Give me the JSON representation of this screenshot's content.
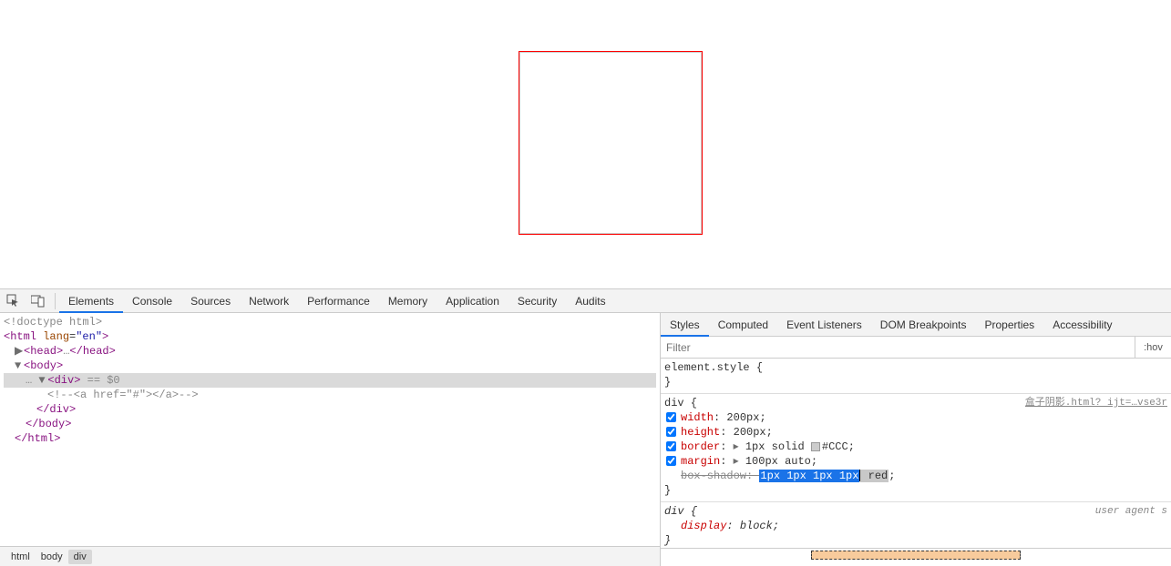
{
  "tabs": [
    "Elements",
    "Console",
    "Sources",
    "Network",
    "Performance",
    "Memory",
    "Application",
    "Security",
    "Audits"
  ],
  "domLines": [
    {
      "indent": 0,
      "html": "<span class='gray'>&lt;!doctype html&gt;</span>"
    },
    {
      "indent": 0,
      "html": "<span class='tagc'>&lt;html </span><span class='attrn'>lang</span>=<span class='attrv'>\"en\"</span><span class='tagc'>&gt;</span>"
    },
    {
      "indent": 1,
      "html": "<span class='arrow'>▶</span><span class='tagc'>&lt;head&gt;</span><span class='gray'>…</span><span class='tagc'>&lt;/head&gt;</span>"
    },
    {
      "indent": 1,
      "html": "<span class='arrow'>▼</span><span class='tagc'>&lt;body&gt;</span>"
    },
    {
      "indent": 2,
      "selected": true,
      "html": "<span class='gray'>…</span> <span class='arrow'>▼</span><span class='tagc'>&lt;div&gt;</span> <span class='eq0'>== $0</span>"
    },
    {
      "indent": 4,
      "html": "<span class='gray'>&lt;!--&lt;a href=\"#\"&gt;&lt;/a&gt;--&gt;</span>"
    },
    {
      "indent": 3,
      "html": "<span class='tagc'>&lt;/div&gt;</span>"
    },
    {
      "indent": 2,
      "html": "<span class='tagc'>&lt;/body&gt;</span>"
    },
    {
      "indent": 1,
      "html": "<span class='tagc'>&lt;/html&gt;</span>"
    }
  ],
  "crumbs": [
    "html",
    "body",
    "div"
  ],
  "crumbSelected": 2,
  "stylesTabs": [
    "Styles",
    "Computed",
    "Event Listeners",
    "DOM Breakpoints",
    "Properties",
    "Accessibility"
  ],
  "filterPlaceholder": "Filter",
  "hovLabel": ":hov",
  "elementStyle": {
    "selector": "element.style {",
    "close": "}"
  },
  "divRule": {
    "selector": "div {",
    "sheetLink": "盒子阴影.html? ijt=…vse3r",
    "props": [
      {
        "name": "width",
        "val": "200px",
        "cb": true
      },
      {
        "name": "height",
        "val": "200px",
        "cb": true
      },
      {
        "name": "border",
        "val": "1px solid ",
        "swatch": true,
        "swHex": "#CCC",
        "cb": true,
        "expand": true
      },
      {
        "name": "margin",
        "val": "100px auto",
        "cb": true,
        "expand": true
      }
    ],
    "shadowName": "box-shadow",
    "shadowBlue": "1px 1px 1px 1px",
    "shadowGray": " red",
    "close": "}"
  },
  "uaRule": {
    "selector": "div {",
    "label": "user agent s",
    "propName": "display",
    "propVal": "block",
    "close": "}"
  }
}
